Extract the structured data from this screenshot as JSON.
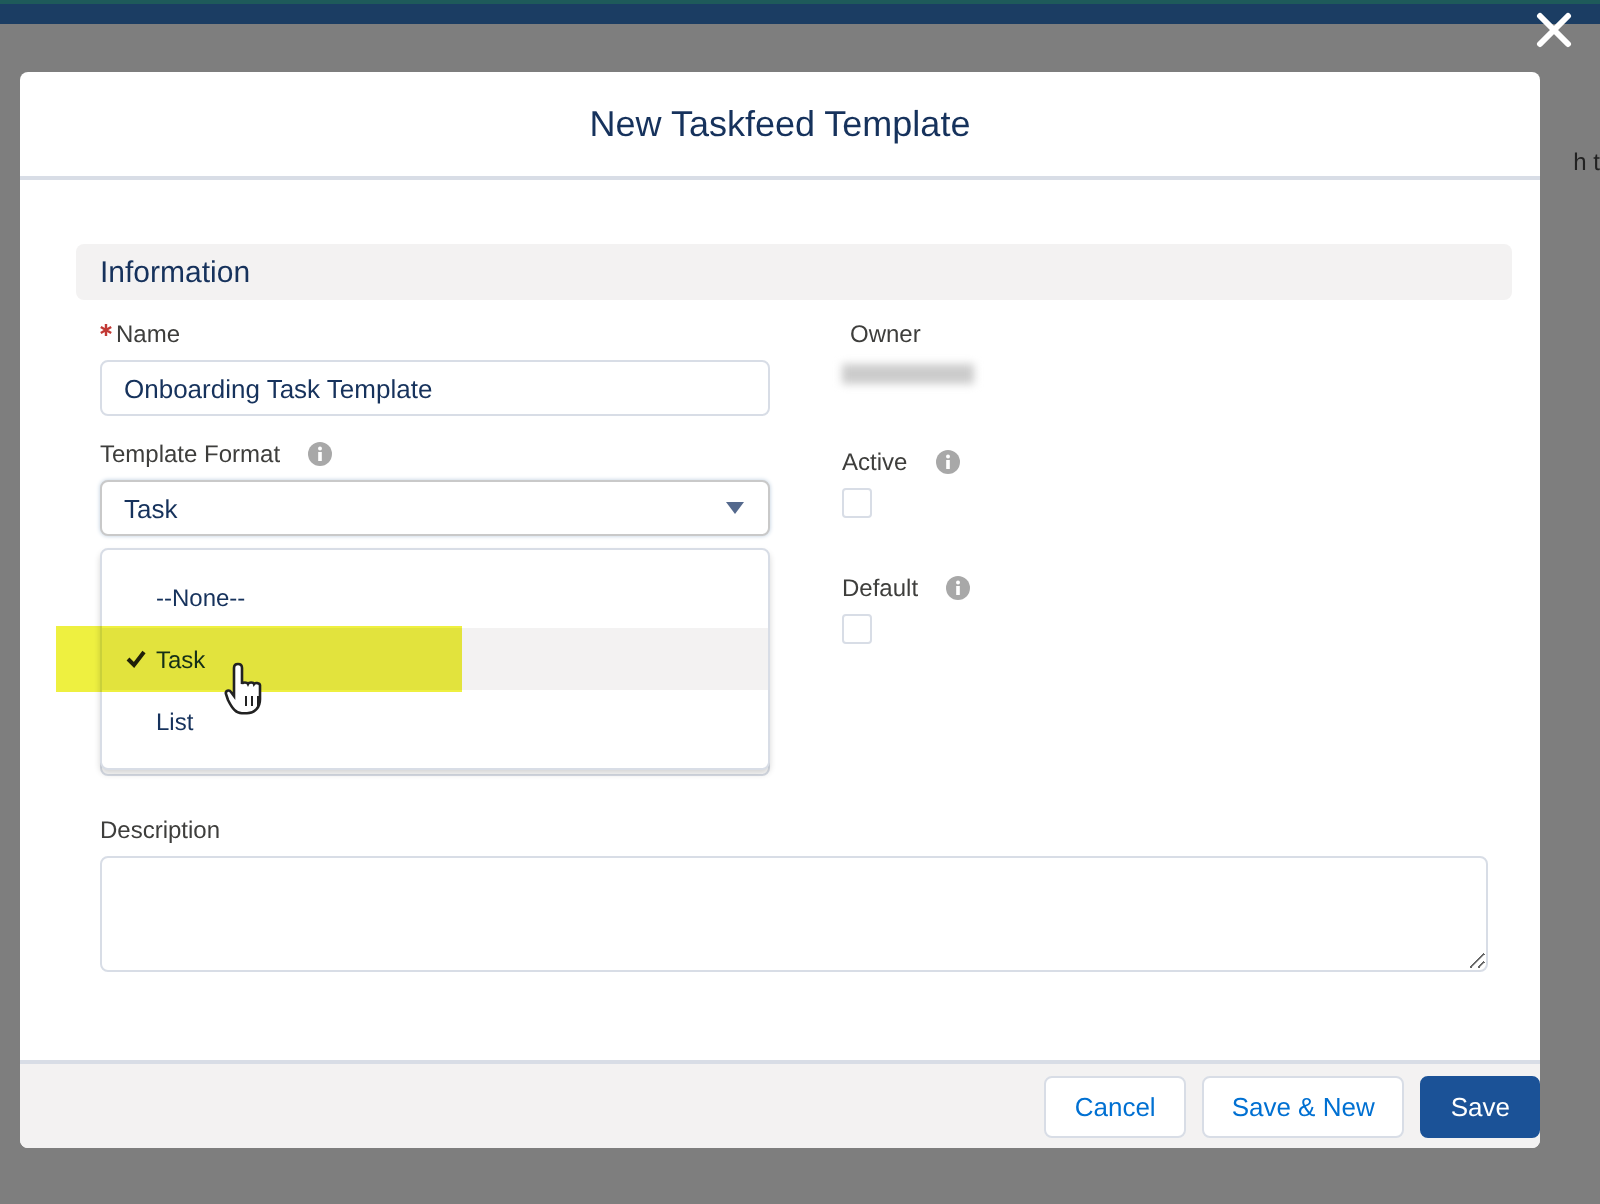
{
  "background": {
    "partial_text": "h t"
  },
  "modal": {
    "title": "New Taskfeed Template",
    "section": "Information",
    "name_field": {
      "label": "Name",
      "required": true,
      "value": "Onboarding Task Template"
    },
    "owner": {
      "label": "Owner"
    },
    "template_format": {
      "label": "Template Format",
      "value": "Task",
      "expanded": true,
      "options": [
        {
          "label": "--None--",
          "selected": false
        },
        {
          "label": "Task",
          "selected": true
        },
        {
          "label": "List",
          "selected": false
        }
      ]
    },
    "active": {
      "label": "Active",
      "checked": false
    },
    "default": {
      "label": "Default",
      "checked": false
    },
    "description": {
      "label": "Description"
    },
    "buttons": [
      {
        "label": "Cancel",
        "kind": "neutral"
      },
      {
        "label": "Save & New",
        "kind": "neutral"
      },
      {
        "label": "Save",
        "kind": "brand"
      }
    ]
  }
}
